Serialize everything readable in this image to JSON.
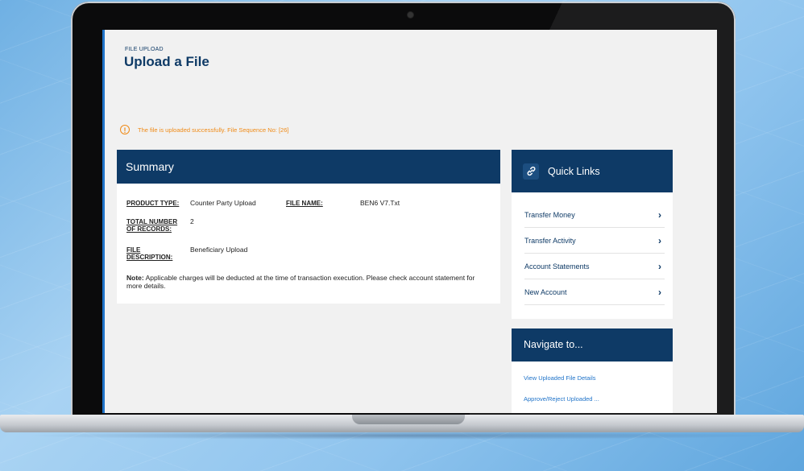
{
  "page": {
    "eyebrow": "FILE UPLOAD",
    "title": "Upload a File"
  },
  "alert": {
    "icon": "info-circle-icon",
    "message": "The file is uploaded successfully. File Sequence No: [26]",
    "color": "#f08a16"
  },
  "summary": {
    "heading": "Summary",
    "product_type_label": "PRODUCT TYPE:",
    "product_type_value": "Counter Party Upload",
    "file_name_label": "FILE NAME:",
    "file_name_value": "BEN6 V7.Txt",
    "total_records_label_1": "TOTAL NUMBER",
    "total_records_label_2": "OF RECORDS:",
    "total_records_value": "2",
    "file_desc_label_1": "FILE",
    "file_desc_label_2": "DESCRIPTION:",
    "file_desc_value": "Beneficiary Upload",
    "note_label": "Note:",
    "note_text": " Applicable charges will be deducted at the time of transaction execution. Please check account statement for more details."
  },
  "quick_links": {
    "title": "Quick Links",
    "icon": "link-icon",
    "items": [
      {
        "label": "Transfer Money"
      },
      {
        "label": "Transfer Activity"
      },
      {
        "label": "Account Statements"
      },
      {
        "label": "New Account"
      }
    ]
  },
  "navigate": {
    "title": "Navigate to...",
    "links": [
      {
        "label": "View Uploaded File Details"
      },
      {
        "label": "Approve/Reject Uploaded ..."
      }
    ]
  },
  "colors": {
    "brand_navy": "#0e3a66",
    "link_blue": "#1f73c9",
    "warning_orange": "#f08a16"
  }
}
